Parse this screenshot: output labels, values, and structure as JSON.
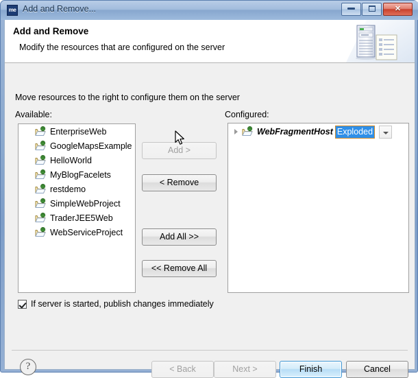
{
  "window": {
    "title": "Add and Remove...",
    "icon_label": "me",
    "icon_name": "app-icon",
    "controls": {
      "minimize": "minimize-icon",
      "maximize": "maximize-icon",
      "close": "✕"
    }
  },
  "banner": {
    "title": "Add and Remove",
    "subtitle": "Modify the resources that are configured on the server",
    "art_name": "server-and-document-illustration"
  },
  "body": {
    "instruction": "Move resources to the right to configure them on the server",
    "available_label": "Available:",
    "configured_label": "Configured:"
  },
  "available": {
    "items": [
      {
        "label": "EnterpriseWeb"
      },
      {
        "label": "GoogleMapsExample"
      },
      {
        "label": "HelloWorld"
      },
      {
        "label": "MyBlogFacelets"
      },
      {
        "label": "restdemo"
      },
      {
        "label": "SimpleWebProject"
      },
      {
        "label": "TraderJEE5Web"
      },
      {
        "label": "WebServiceProject"
      }
    ]
  },
  "configured": {
    "items": [
      {
        "name": "WebFragmentHost",
        "value": "Exploded",
        "expanded": false
      }
    ]
  },
  "transfer_buttons": {
    "add": "Add >",
    "add_enabled": false,
    "remove": "< Remove",
    "add_all": "Add All >>",
    "remove_all": "<< Remove All"
  },
  "checkbox": {
    "label": "If server is started, publish changes immediately",
    "checked": true
  },
  "footer": {
    "help": "?",
    "back": "< Back",
    "back_enabled": false,
    "next": "Next >",
    "next_enabled": false,
    "finish": "Finish",
    "cancel": "Cancel"
  },
  "colors": {
    "selection_blue": "#2f8fe8",
    "title_bar_blue": "#a2bcdd",
    "close_red": "#c8402c",
    "default_button_border": "#3c95d4"
  }
}
